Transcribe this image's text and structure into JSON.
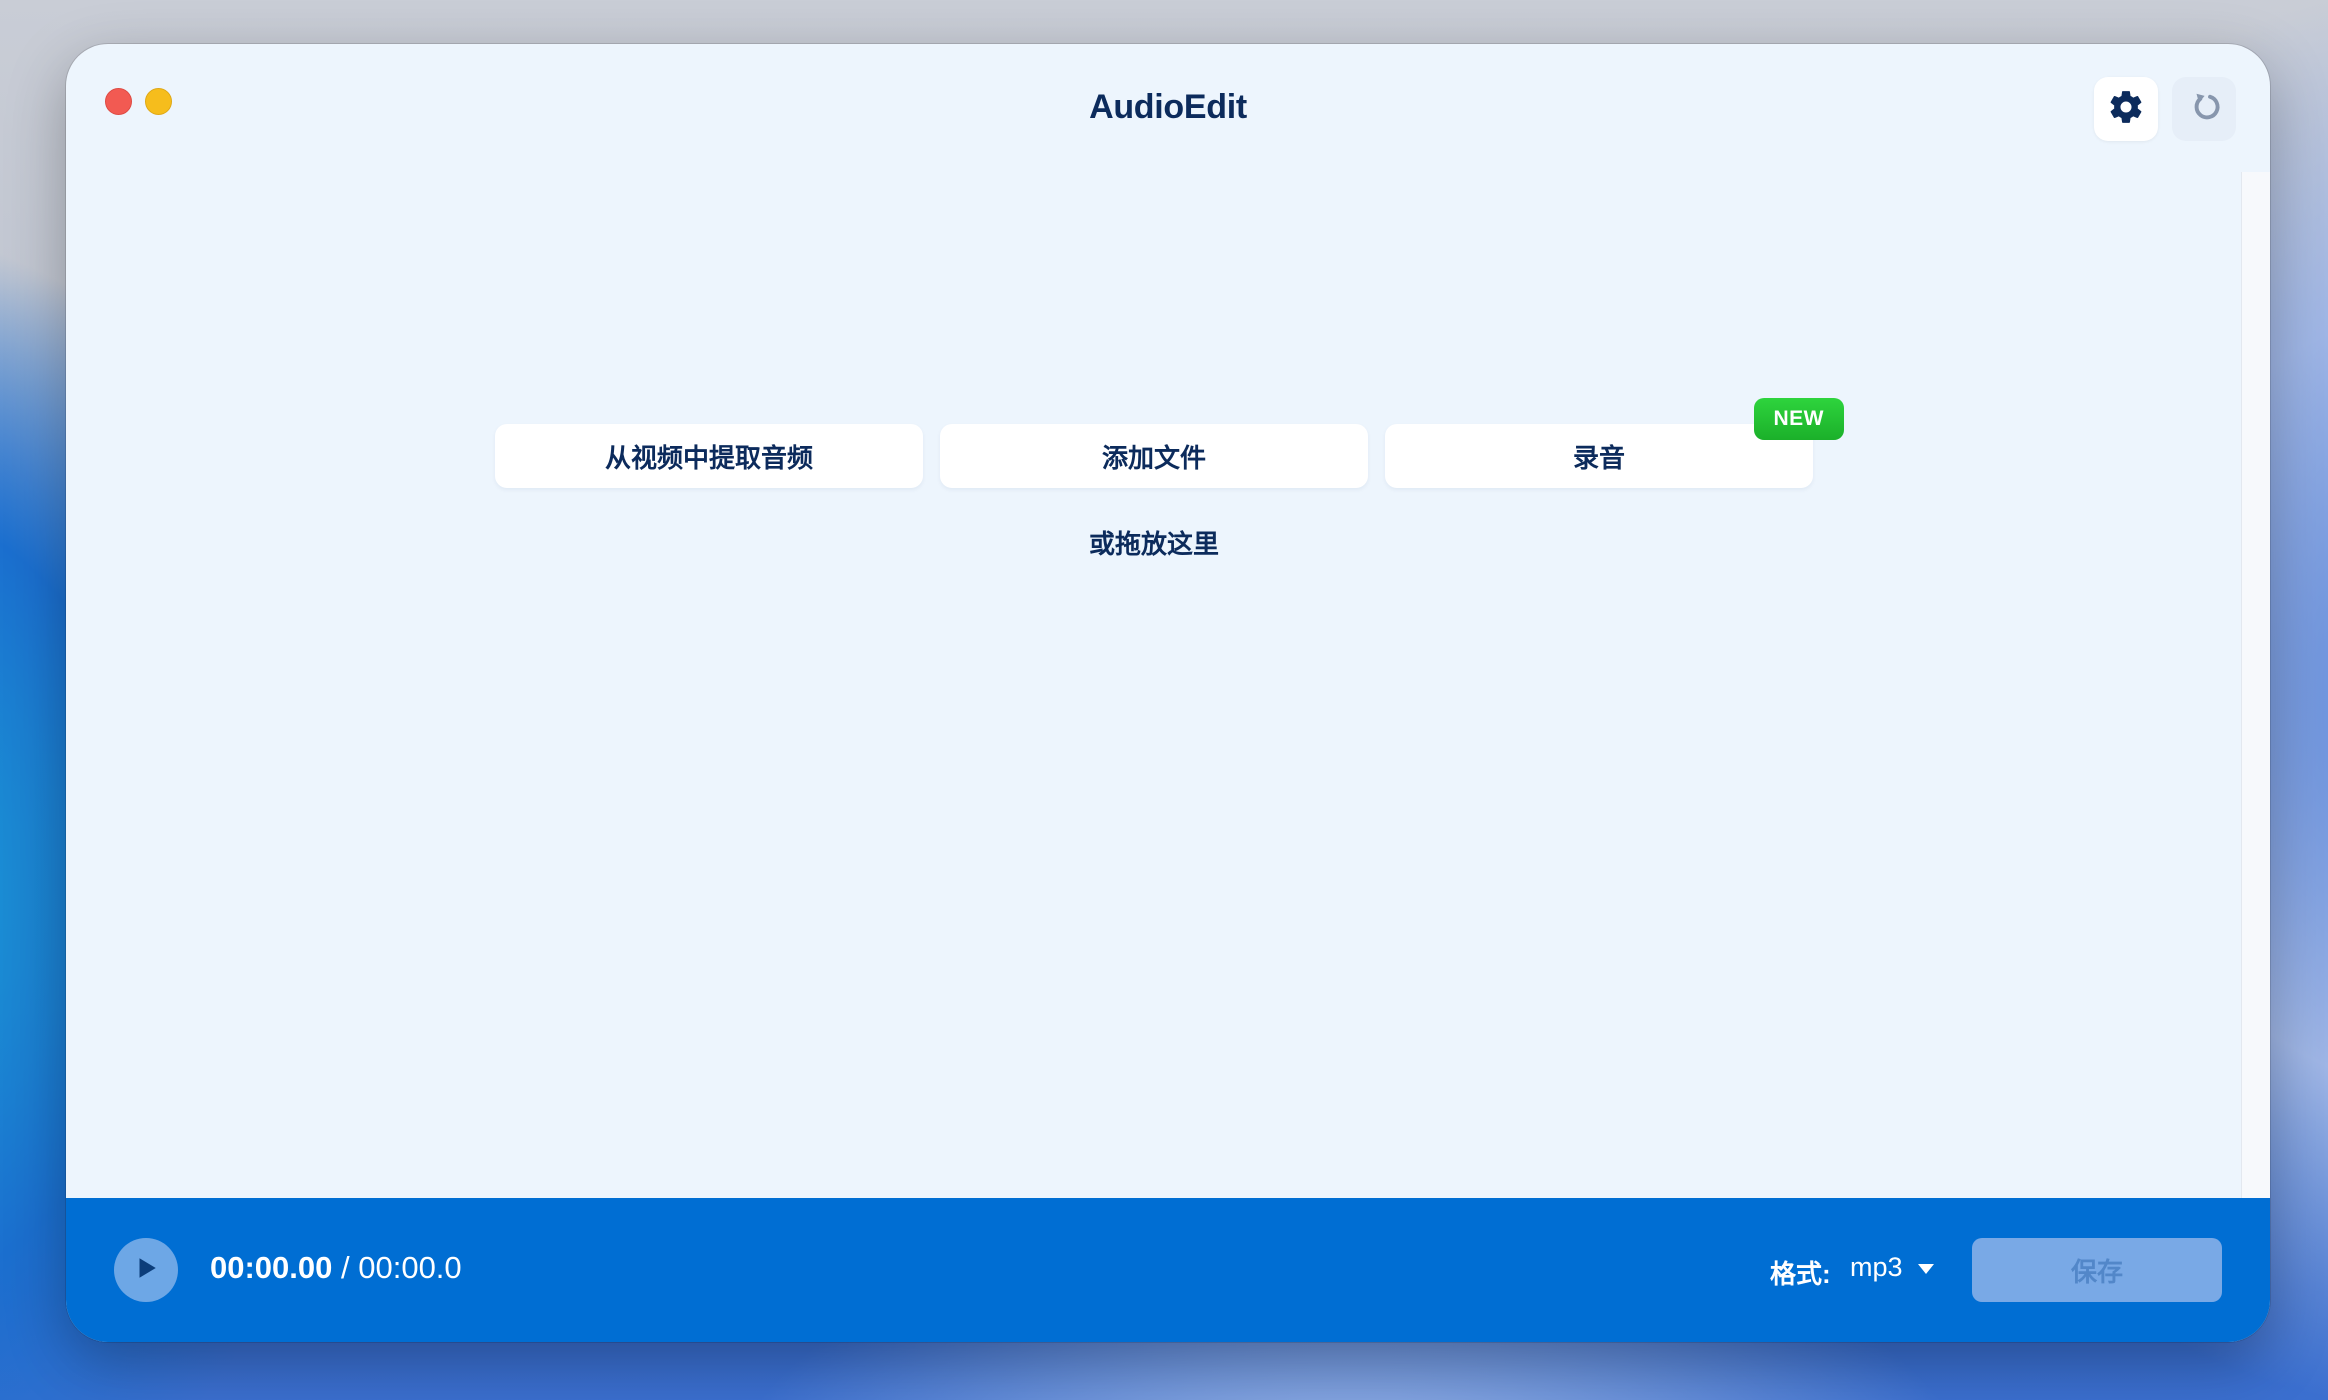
{
  "window": {
    "title": "AudioEdit"
  },
  "toolbar": {
    "settings_icon": "gear-icon",
    "reset_icon": "undo-icon"
  },
  "actions": {
    "extract_audio_label": "从视频中提取音频",
    "add_file_label": "添加文件",
    "record_label": "录音",
    "new_badge": "NEW",
    "drop_hint": "或拖放这里"
  },
  "player": {
    "current_time": "00:00.00",
    "separator": " / ",
    "total_time": "00:00.0",
    "play_icon": "play-icon"
  },
  "export": {
    "format_label": "格式:",
    "format_value": "mp3",
    "save_label": "保存"
  },
  "colors": {
    "window_bg": "#edf5fd",
    "text_primary": "#0c2b5c",
    "bottom_bar": "#006ed3",
    "badge_green": "#1bb02a",
    "save_disabled": "#79a9e6"
  }
}
